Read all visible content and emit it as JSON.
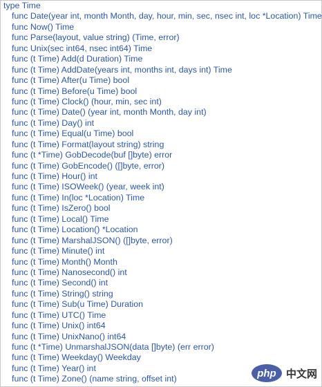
{
  "type_line": "type Time",
  "funcs": [
    "func Date(year int, month Month, day, hour, min, sec, nsec int, loc *Location) Time",
    "func Now() Time",
    "func Parse(layout, value string) (Time, error)",
    "func Unix(sec int64, nsec int64) Time",
    "func (t Time) Add(d Duration) Time",
    "func (t Time) AddDate(years int, months int, days int) Time",
    "func (t Time) After(u Time) bool",
    "func (t Time) Before(u Time) bool",
    "func (t Time) Clock() (hour, min, sec int)",
    "func (t Time) Date() (year int, month Month, day int)",
    "func (t Time) Day() int",
    "func (t Time) Equal(u Time) bool",
    "func (t Time) Format(layout string) string",
    "func (t *Time) GobDecode(buf []byte) error",
    "func (t Time) GobEncode() ([]byte, error)",
    "func (t Time) Hour() int",
    "func (t Time) ISOWeek() (year, week int)",
    "func (t Time) In(loc *Location) Time",
    "func (t Time) IsZero() bool",
    "func (t Time) Local() Time",
    "func (t Time) Location() *Location",
    "func (t Time) MarshalJSON() ([]byte, error)",
    "func (t Time) Minute() int",
    "func (t Time) Month() Month",
    "func (t Time) Nanosecond() int",
    "func (t Time) Second() int",
    "func (t Time) String() string",
    "func (t Time) Sub(u Time) Duration",
    "func (t Time) UTC() Time",
    "func (t Time) Unix() int64",
    "func (t Time) UnixNano() int64",
    "func (t *Time) UnmarshalJSON(data []byte) (err error)",
    "func (t Time) Weekday() Weekday",
    "func (t Time) Year() int",
    "func (t Time) Zone() (name string, offset int)"
  ],
  "watermark": {
    "badge": "php",
    "text": "中文网"
  },
  "colors": {
    "link_text": "#2a56b0",
    "badge_bg": "#4a5fa8"
  }
}
